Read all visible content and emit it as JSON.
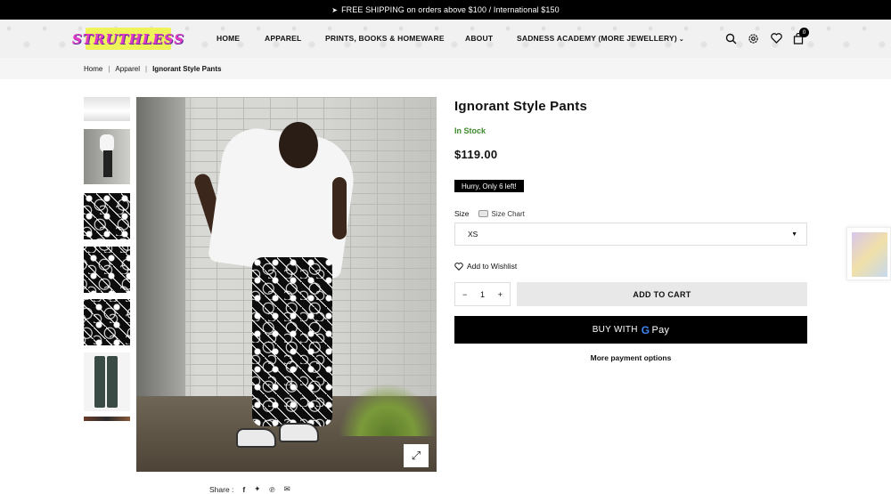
{
  "announcement": {
    "icon": "paper-plane-icon",
    "text": "FREE SHIPPING on orders above $100 / International $150"
  },
  "header": {
    "logo_text": "STRUTHLESS",
    "nav": [
      "HOME",
      "APPAREL",
      "PRINTS, BOOKS & HOMEWARE",
      "ABOUT",
      "SADNESS ACADEMY (MORE JEWELLERY)"
    ],
    "icons": [
      "search-icon",
      "settings-icon",
      "heart-icon",
      "bag-icon"
    ],
    "cart_count": "0"
  },
  "breadcrumb": [
    "Home",
    "Apparel",
    "Ignorant Style Pants"
  ],
  "product": {
    "title": "Ignorant Style Pants",
    "stock": "In Stock",
    "price": "$119.00",
    "badge": "Hurry, Only 6 left!",
    "size_label": "Size",
    "size_chart": "Size Chart",
    "size_selected": "XS",
    "wishlist": "Add to Wishlist",
    "qty_minus": "−",
    "qty": "1",
    "qty_plus": "+",
    "add_to_cart": "ADD TO CART",
    "buy_with": "BUY WITH",
    "gpay_g": "G",
    "gpay_pay": "Pay",
    "more_payment": "More payment options"
  },
  "share": {
    "label": "Share :",
    "icons": [
      "facebook-icon",
      "twitter-icon",
      "pinterest-icon",
      "email-icon"
    ]
  },
  "colors": {
    "accent": "#000000",
    "stock_green": "#3b8a2a",
    "logo_bg": "#eef35a",
    "logo_text": "#e23ac7"
  }
}
